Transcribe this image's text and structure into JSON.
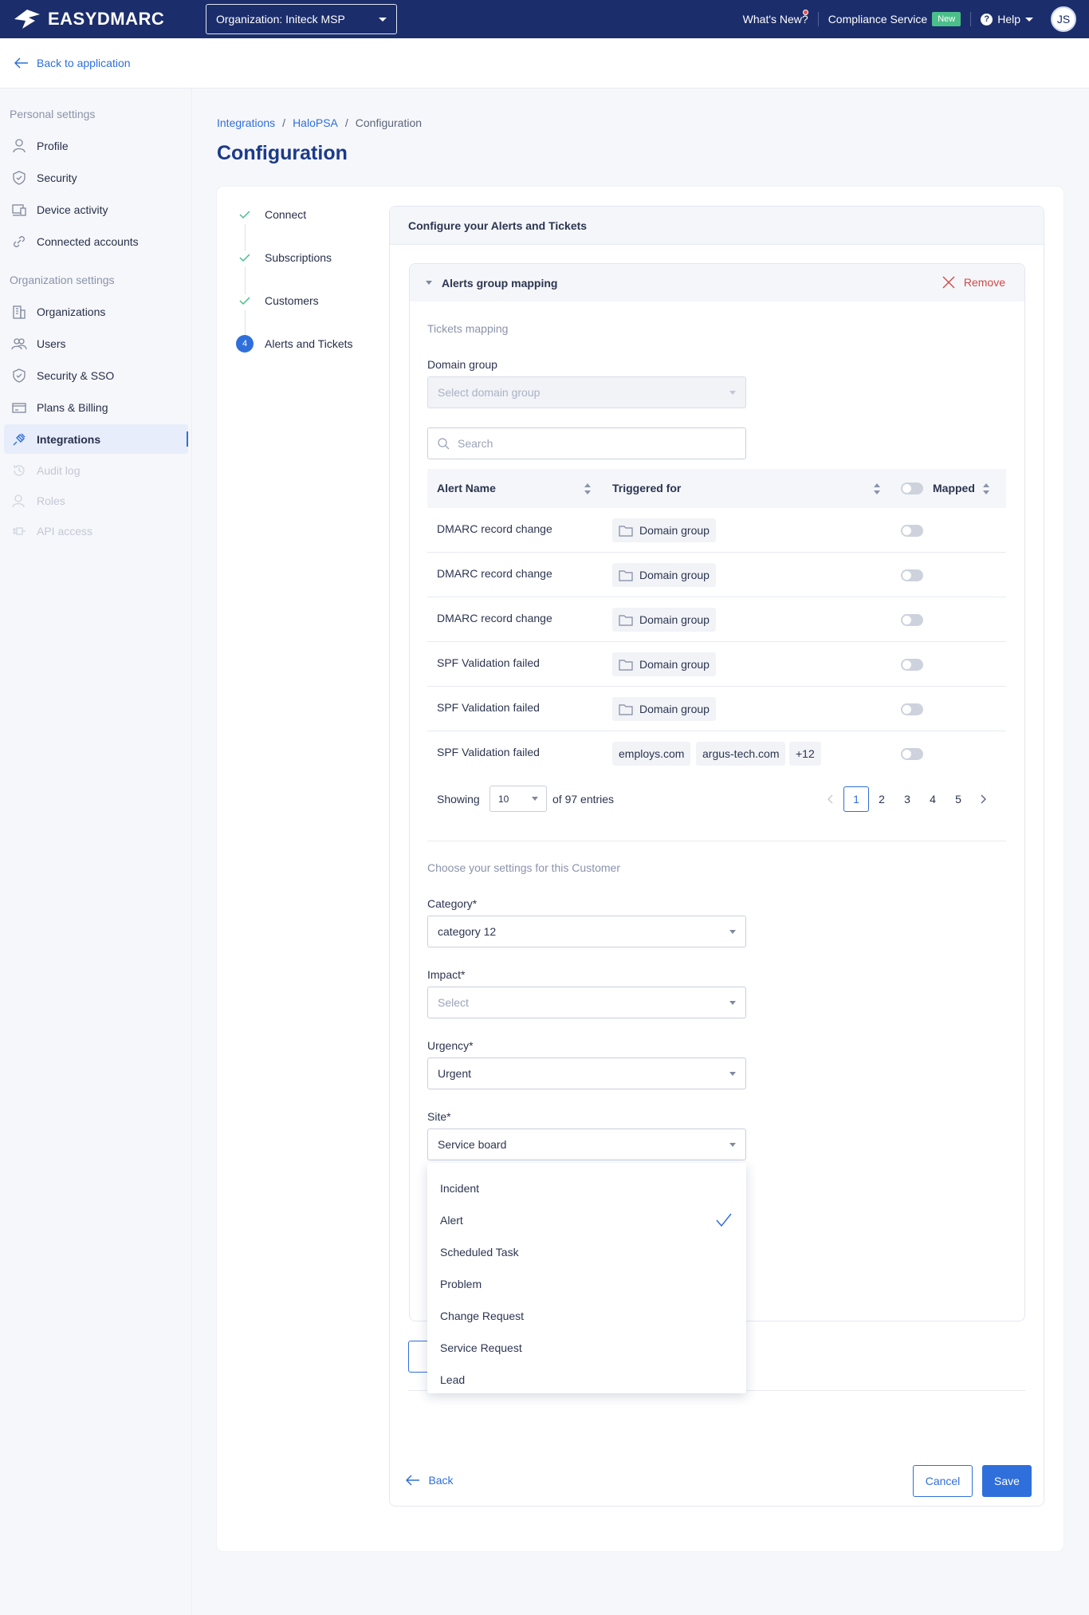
{
  "brand": {
    "name": "EASYDMARC"
  },
  "topbar": {
    "org_selector": "Organization: Initeck MSP",
    "whats_new": "What's New?",
    "compliance": "Compliance Service",
    "new_badge": "New",
    "help": "Help",
    "avatar": "JS"
  },
  "back_link": "Back to application",
  "sidebar": {
    "personal_heading": "Personal settings",
    "personal": [
      {
        "label": "Profile",
        "icon": "user-icon"
      },
      {
        "label": "Security",
        "icon": "shield-icon"
      },
      {
        "label": "Device activity",
        "icon": "devices-icon"
      },
      {
        "label": "Connected accounts",
        "icon": "link-icon"
      }
    ],
    "org_heading": "Organization settings",
    "org": [
      {
        "label": "Organizations",
        "icon": "building-icon"
      },
      {
        "label": "Users",
        "icon": "users-icon"
      },
      {
        "label": "Security & SSO",
        "icon": "shield-icon"
      },
      {
        "label": "Plans & Billing",
        "icon": "credit-card-icon"
      },
      {
        "label": "Integrations",
        "icon": "plug-icon",
        "active": true
      },
      {
        "label": "Audit log",
        "icon": "history-icon",
        "disabled": true
      },
      {
        "label": "Roles",
        "icon": "roles-icon",
        "disabled": true
      },
      {
        "label": "API access",
        "icon": "api-icon",
        "disabled": true
      }
    ]
  },
  "breadcrumb": {
    "items": [
      "Integrations",
      "HaloPSA",
      "Configuration"
    ]
  },
  "page_title": "Configuration",
  "stepper": {
    "steps": [
      {
        "label": "Connect",
        "state": "done"
      },
      {
        "label": "Subscriptions",
        "state": "done"
      },
      {
        "label": "Customers",
        "state": "done"
      },
      {
        "label": "Alerts and Tickets",
        "state": "current",
        "number": "4"
      }
    ]
  },
  "config": {
    "header": "Configure your Alerts and Tickets",
    "group": {
      "title": "Alerts group mapping",
      "remove": "Remove",
      "tickets_mapping": "Tickets mapping",
      "domain_group_label": "Domain group",
      "domain_group_placeholder": "Select domain group",
      "search_placeholder": "Search",
      "table": {
        "columns": [
          "Alert Name",
          "Triggered for",
          "Mapped"
        ],
        "rows": [
          {
            "name": "DMARC record change",
            "triggered": [
              "Domain group"
            ],
            "mapped": false
          },
          {
            "name": "DMARC record change",
            "triggered": [
              "Domain group"
            ],
            "mapped": false
          },
          {
            "name": "DMARC record change",
            "triggered": [
              "Domain group"
            ],
            "mapped": false
          },
          {
            "name": "SPF Validation failed",
            "triggered": [
              "Domain group"
            ],
            "mapped": false
          },
          {
            "name": "SPF Validation failed",
            "triggered": [
              "Domain group"
            ],
            "mapped": false
          },
          {
            "name": "SPF Validation failed",
            "triggered": [
              "employs.com",
              "argus-tech.com",
              "+12"
            ],
            "mapped": false
          }
        ]
      },
      "pagination": {
        "showing": "Showing",
        "page_size": "10",
        "of_entries": "of 97 entries",
        "pages": [
          "1",
          "2",
          "3",
          "4",
          "5"
        ],
        "current": "1"
      },
      "settings_heading": "Choose your settings for this Customer",
      "fields": [
        {
          "label": "Category*",
          "value": "category 12",
          "placeholder": false
        },
        {
          "label": "Impact*",
          "value": "Select",
          "placeholder": true
        },
        {
          "label": "Urgency*",
          "value": "Urgent",
          "placeholder": false
        },
        {
          "label": "Site*",
          "value": "Service board",
          "placeholder": false
        }
      ],
      "dropdown_options": [
        "Incident",
        "Alert",
        "Scheduled Task",
        "Problem",
        "Change Request",
        "Service Request",
        "Lead"
      ],
      "dropdown_selected": "Alert"
    }
  },
  "footer": {
    "back": "Back",
    "cancel": "Cancel",
    "save": "Save"
  },
  "colors": {
    "navy": "#1b2d6b",
    "accent": "#2f6fdb",
    "remove": "#d04848",
    "new_badge": "#4bbf8a"
  }
}
